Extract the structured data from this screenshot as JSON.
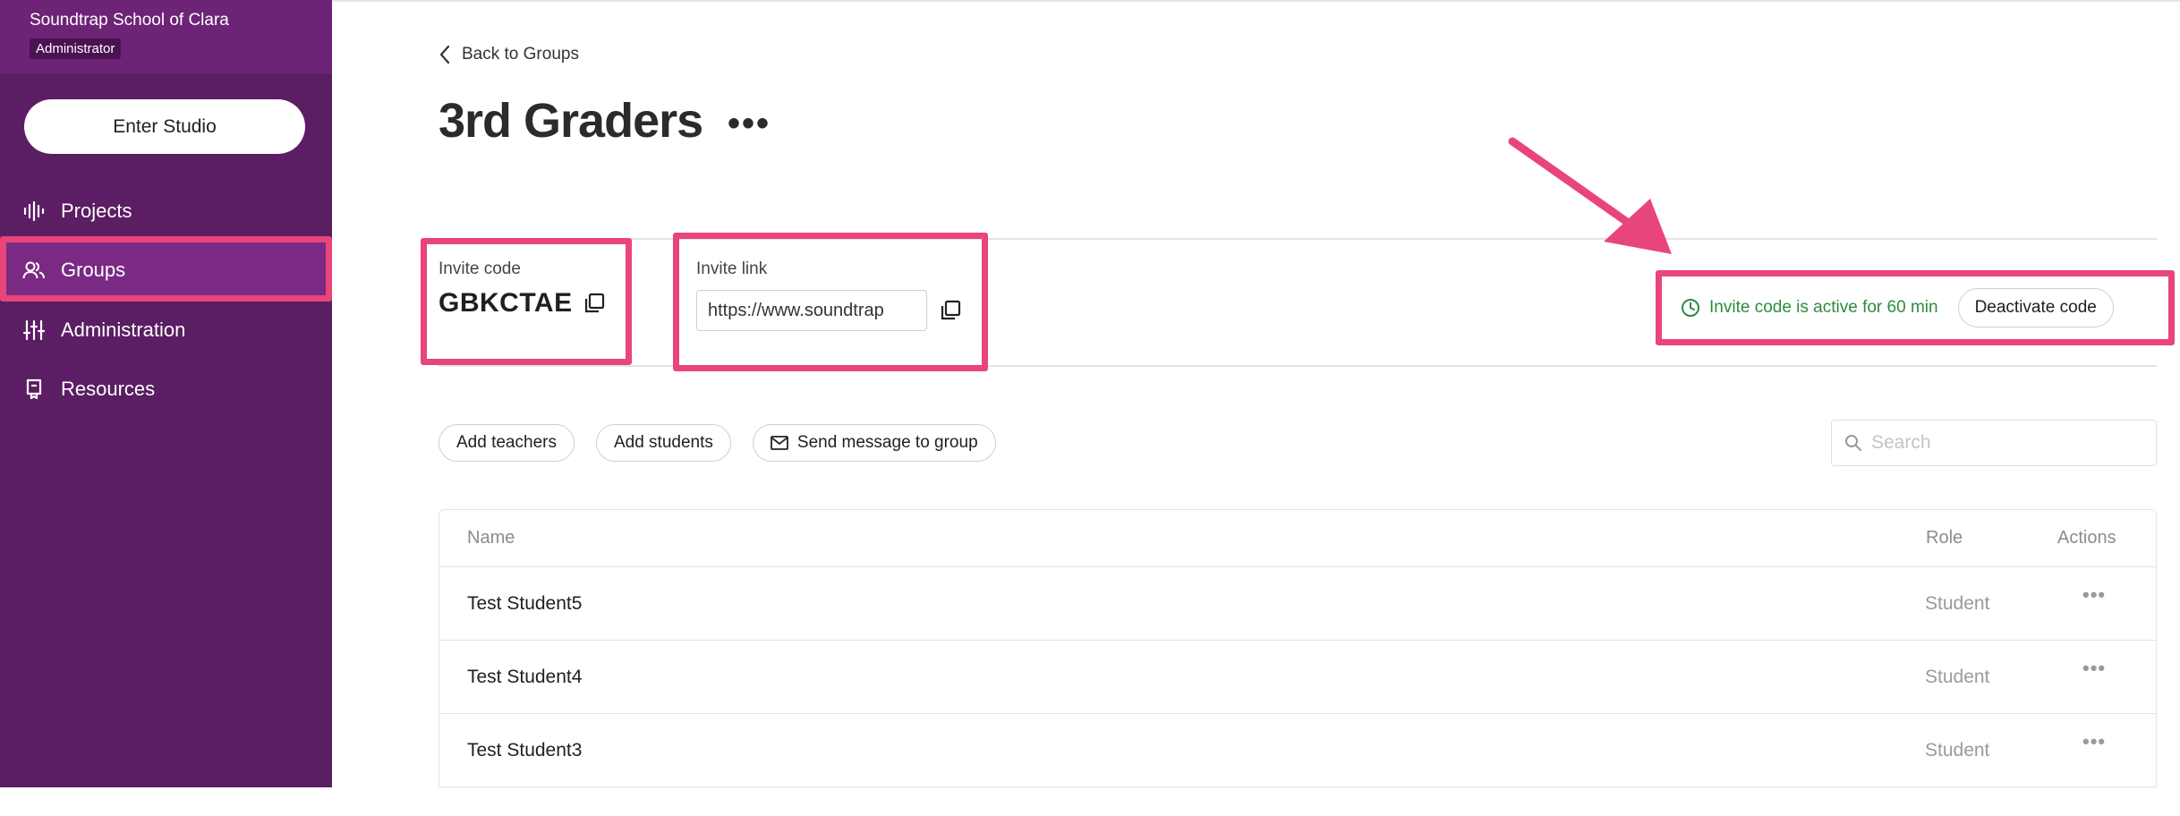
{
  "sidebar": {
    "org_name": "Soundtrap School of Clara",
    "role_badge": "Administrator",
    "enter_studio_label": "Enter Studio",
    "items": [
      {
        "label": "Projects",
        "icon": "waveform-icon"
      },
      {
        "label": "Groups",
        "icon": "people-icon",
        "active": true
      },
      {
        "label": "Administration",
        "icon": "sliders-icon"
      },
      {
        "label": "Resources",
        "icon": "bookmark-icon"
      }
    ]
  },
  "header": {
    "back_label": "Back to Groups",
    "title": "3rd Graders",
    "more_label": "•••"
  },
  "invite": {
    "code_label": "Invite code",
    "code_value": "GBKCTAE",
    "link_label": "Invite link",
    "link_value": "https://www.soundtrap",
    "status_text": "Invite code is active for 60 min",
    "deactivate_label": "Deactivate code"
  },
  "actions": {
    "add_teachers": "Add teachers",
    "add_students": "Add students",
    "send_message": "Send message to group"
  },
  "search": {
    "placeholder": "Search"
  },
  "table": {
    "columns": {
      "name": "Name",
      "role": "Role",
      "actions": "Actions"
    },
    "rows": [
      {
        "name": "Test Student5",
        "role": "Student",
        "more": "•••"
      },
      {
        "name": "Test Student4",
        "role": "Student",
        "more": "•••"
      },
      {
        "name": "Test Student3",
        "role": "Student",
        "more": "•••"
      }
    ]
  },
  "colors": {
    "sidebar_bg": "#5b1d63",
    "sidebar_header_bg": "#6e2476",
    "active_item_bg": "#7a2a83",
    "highlight": "#e8457a",
    "status_green": "#2e8b3d"
  }
}
